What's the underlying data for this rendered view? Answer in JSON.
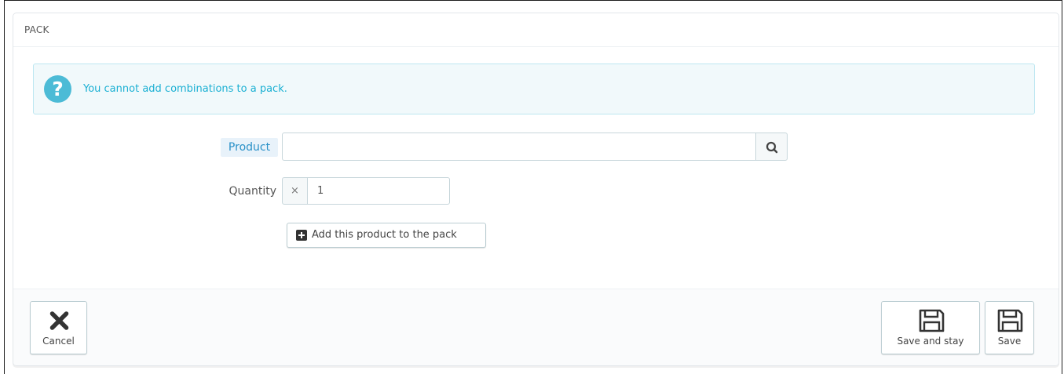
{
  "panel": {
    "title": "PACK"
  },
  "alert": {
    "icon": "question-icon",
    "glyph": "?",
    "text": "You cannot add combinations to a pack."
  },
  "form": {
    "product_label": "Product",
    "product_value": "",
    "search_icon": "search-icon",
    "quantity_label": "Quantity",
    "quantity_prefix": "×",
    "quantity_value": "1",
    "add_button_label": "Add this product to the pack",
    "add_button_icon": "plus-square-icon"
  },
  "footer": {
    "cancel_label": "Cancel",
    "cancel_icon": "close-icon",
    "save_stay_label": "Save and stay",
    "save_stay_icon": "floppy-disk-icon",
    "save_label": "Save",
    "save_icon": "floppy-disk-icon"
  },
  "colors": {
    "accent": "#25b9d7",
    "alert_bg": "#f1f9fb",
    "alert_border": "#bde7f1",
    "label_highlight_bg": "#e8f2fa"
  }
}
